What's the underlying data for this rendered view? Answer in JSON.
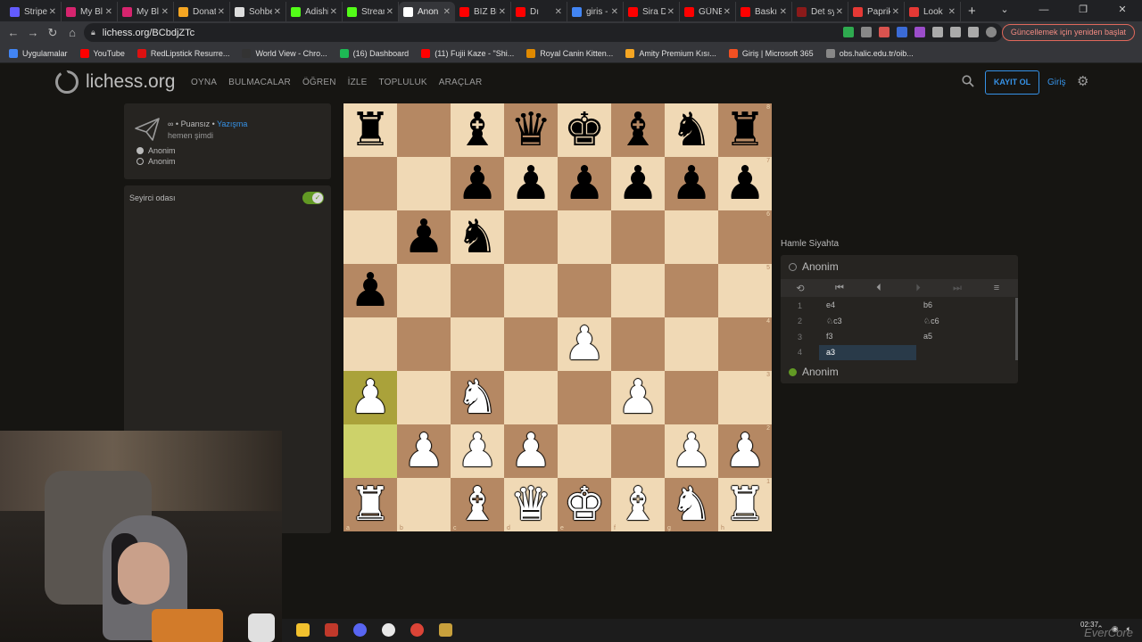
{
  "browser": {
    "tabs": [
      {
        "title": "Stripe",
        "color": "#635bff"
      },
      {
        "title": "My Bl",
        "color": "#d6246e"
      },
      {
        "title": "My Bl",
        "color": "#d6246e"
      },
      {
        "title": "Donat",
        "color": "#f5a623"
      },
      {
        "title": "Sohbe",
        "color": "#dddddd"
      },
      {
        "title": "Adishi",
        "color": "#53fc18"
      },
      {
        "title": "Stream",
        "color": "#53fc18"
      },
      {
        "title": "Anon",
        "color": "#ffffff"
      },
      {
        "title": "BİZ Bİ",
        "color": "#ff0000"
      },
      {
        "title": "Dı",
        "color": "#ff0000"
      },
      {
        "title": "giris -",
        "color": "#4285f4"
      },
      {
        "title": "Sira D",
        "color": "#ff0000"
      },
      {
        "title": "GÜNE",
        "color": "#ff0000"
      },
      {
        "title": "Baskı",
        "color": "#ff0000"
      },
      {
        "title": "Det sy",
        "color": "#8b1a1a"
      },
      {
        "title": "Paprik",
        "color": "#e53935"
      },
      {
        "title": "Look",
        "color": "#e53935"
      }
    ],
    "url": "lichess.org/BCbdjZTc",
    "update_button": "Güncellemek için yeniden başlat",
    "bookmarks": [
      {
        "label": "Uygulamalar",
        "color": "#4285f4"
      },
      {
        "label": "YouTube",
        "color": "#ff0000"
      },
      {
        "label": "RedLipstick Resurre...",
        "color": "#d11"
      },
      {
        "label": "World View - Chro...",
        "color": "#333"
      },
      {
        "label": "(16) Dashboard",
        "color": "#1db954"
      },
      {
        "label": "(11) Fujii Kaze - \"Shi...",
        "color": "#ff0000"
      },
      {
        "label": "Royal Canin Kitten...",
        "color": "#e08a00"
      },
      {
        "label": "Amity Premium Kısı...",
        "color": "#f5a623"
      },
      {
        "label": "Giriş | Microsoft 365",
        "color": "#f25022"
      },
      {
        "label": "obs.halic.edu.tr/oib...",
        "color": "#888"
      }
    ]
  },
  "site": {
    "logo": "lichess.org",
    "nav": [
      "OYNA",
      "BULMACALAR",
      "ÖĞREN",
      "İZLE",
      "TOPLULUK",
      "ARAÇLAR"
    ],
    "signup": "KAYIT OL",
    "login": "Giriş",
    "accent": "#3692e7"
  },
  "game": {
    "meta_prefix": "∞ • Puansız • ",
    "meta_link": "Yazışma",
    "time": "hemen şimdi",
    "player_white": "Anonim",
    "player_black": "Anonim"
  },
  "spectator": {
    "title": "Seyirci odası",
    "enabled": true
  },
  "board": {
    "position": [
      [
        "bR",
        "",
        "bB",
        "bQ",
        "bK",
        "bB",
        "bN",
        "bR"
      ],
      [
        "",
        "",
        "bP",
        "bP",
        "bP",
        "bP",
        "bP",
        "bP"
      ],
      [
        "",
        "bP",
        "bN",
        "",
        "",
        "",
        "",
        ""
      ],
      [
        "bP",
        "",
        "",
        "",
        "",
        "",
        "",
        ""
      ],
      [
        "",
        "",
        "",
        "",
        "wP",
        "",
        "",
        ""
      ],
      [
        "wP",
        "",
        "wN",
        "",
        "",
        "wP",
        "",
        ""
      ],
      [
        "",
        "wP",
        "wP",
        "wP",
        "",
        "",
        "wP",
        "wP"
      ],
      [
        "wR",
        "",
        "wB",
        "wQ",
        "wK",
        "wB",
        "wN",
        "wR"
      ]
    ],
    "last_move": [
      "a2",
      "a3"
    ],
    "ranks": [
      "8",
      "7",
      "6",
      "5",
      "4",
      "3",
      "2",
      "1"
    ],
    "files": [
      "a",
      "b",
      "c",
      "d",
      "e",
      "f",
      "g",
      "h"
    ]
  },
  "moves_panel": {
    "turn_label": "Hamle Siyahta",
    "top_player": "Anonim",
    "bottom_player": "Anonim",
    "moves": [
      {
        "num": "1",
        "white": "e4",
        "black": "b6"
      },
      {
        "num": "2",
        "white": "♘c3",
        "black": "♘c6"
      },
      {
        "num": "3",
        "white": "f3",
        "black": "a5"
      },
      {
        "num": "4",
        "white": "a3",
        "black": ""
      }
    ],
    "active_move": "a3"
  },
  "taskbar": {
    "clock": "02:37",
    "watermark": "EverCore"
  }
}
